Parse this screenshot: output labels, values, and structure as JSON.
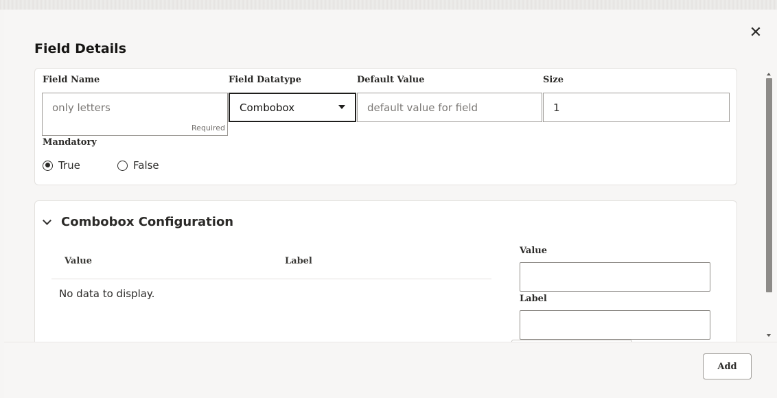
{
  "dialog": {
    "title": "Field Details",
    "close_glyph": "✕",
    "close_icon": "close-icon"
  },
  "fields": {
    "field_name": {
      "label": "Field Name",
      "placeholder": "only letters",
      "hint": "Required"
    },
    "field_datatype": {
      "label": "Field Datatype",
      "value": "Combobox",
      "icon": "chevron-down-icon"
    },
    "default_value": {
      "label": "Default Value",
      "placeholder": "default value for field"
    },
    "size": {
      "label": "Size",
      "value": "1"
    },
    "mandatory": {
      "label": "Mandatory",
      "options": [
        {
          "label": "True",
          "selected": true
        },
        {
          "label": "False",
          "selected": false
        }
      ]
    }
  },
  "combobox_config": {
    "title": "Combobox Configuration",
    "icon": "chevron-down-icon",
    "table": {
      "columns": [
        "Value",
        "Label"
      ],
      "empty_text": "No data to display."
    },
    "form": {
      "value_label": "Value",
      "label_label": "Label"
    }
  },
  "footer": {
    "add_label": "Add"
  },
  "colors": {
    "background": "#f7f6f5",
    "card": "#ffffff",
    "text": "#161513",
    "scroll_thumb": "#8d8b88"
  }
}
